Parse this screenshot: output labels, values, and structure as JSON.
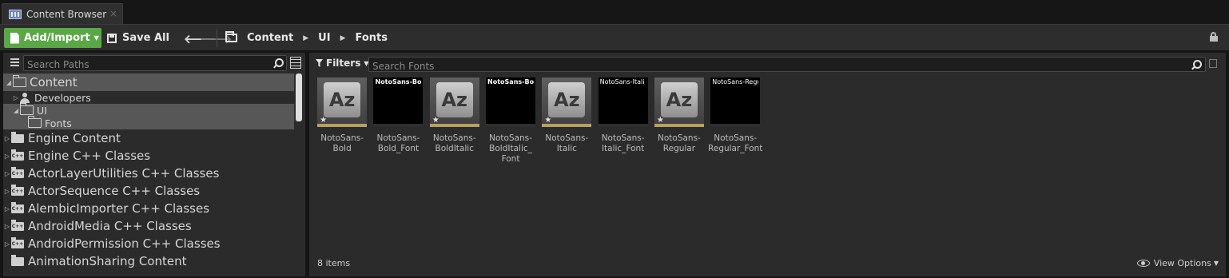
{
  "window": {
    "tab_label": "Content Browser",
    "tab_close": "×"
  },
  "toolbar": {
    "add_import_label": "Add/Import",
    "save_all_label": "Save All",
    "back_glyph": "🡐",
    "forward_glyph": "🡒",
    "breadcrumbs": [
      "Content",
      "UI",
      "Fonts"
    ],
    "crumb_arrow": "▶"
  },
  "sources": {
    "search_placeholder": "Search Paths",
    "tree": [
      {
        "label": "Content",
        "expanded": true
      },
      {
        "label": "Developers",
        "expanded": false
      },
      {
        "label": "UI",
        "expanded": true
      },
      {
        "label": "Fonts",
        "selected": true
      },
      {
        "label": "Engine Content"
      },
      {
        "label": "Engine C++ Classes"
      },
      {
        "label": "ActorLayerUtilities C++ Classes"
      },
      {
        "label": "ActorSequence C++ Classes"
      },
      {
        "label": "AlembicImporter C++ Classes"
      },
      {
        "label": "AndroidMedia C++ Classes"
      },
      {
        "label": "AndroidPermission C++ Classes"
      },
      {
        "label": "AnimationSharing Content"
      }
    ],
    "cpp_badge": "C++",
    "tri_collapsed": "▷",
    "tri_expanded": "◢"
  },
  "assets_panel": {
    "filters_label": "Filters",
    "search_placeholder": "Search Fonts",
    "items": [
      {
        "type": "font-face",
        "glyph": "Az",
        "name": "NotoSans-Bold"
      },
      {
        "type": "font",
        "preview": "NotoSans-Bold",
        "name": "NotoSans-Bold_Font"
      },
      {
        "type": "font-face",
        "glyph": "Az",
        "name": "NotoSans-BoldItalic"
      },
      {
        "type": "font",
        "preview": "NotoSans-Bold",
        "name": "NotoSans-BoldItalic_Font"
      },
      {
        "type": "font-face",
        "glyph": "Az",
        "name": "NotoSans-Italic"
      },
      {
        "type": "font",
        "preview": "NotoSans-Itali",
        "name": "NotoSans-Italic_Font"
      },
      {
        "type": "font-face",
        "glyph": "Az",
        "name": "NotoSans-Regular"
      },
      {
        "type": "font",
        "preview": "NotoSans-Regu",
        "name": "NotoSans-Regular_Font"
      }
    ],
    "item_lines": [
      [
        "NotoSans-",
        "Bold"
      ],
      [
        "NotoSans-",
        "Bold_Font"
      ],
      [
        "NotoSans-",
        "BoldItalic"
      ],
      [
        "NotoSans-",
        "BoldItalic_",
        "Font"
      ],
      [
        "NotoSans-",
        "Italic"
      ],
      [
        "NotoSans-",
        "Italic_Font"
      ],
      [
        "NotoSans-",
        "Regular"
      ],
      [
        "NotoSans-",
        "Regular_Font"
      ]
    ],
    "status": "8 items",
    "view_options_label": "View Options",
    "star": "★"
  },
  "colors": {
    "accent_green": "#5aa845",
    "font_face_bar": "#b7a25b",
    "selection": "#575757",
    "panel": "#2b2b2b"
  }
}
